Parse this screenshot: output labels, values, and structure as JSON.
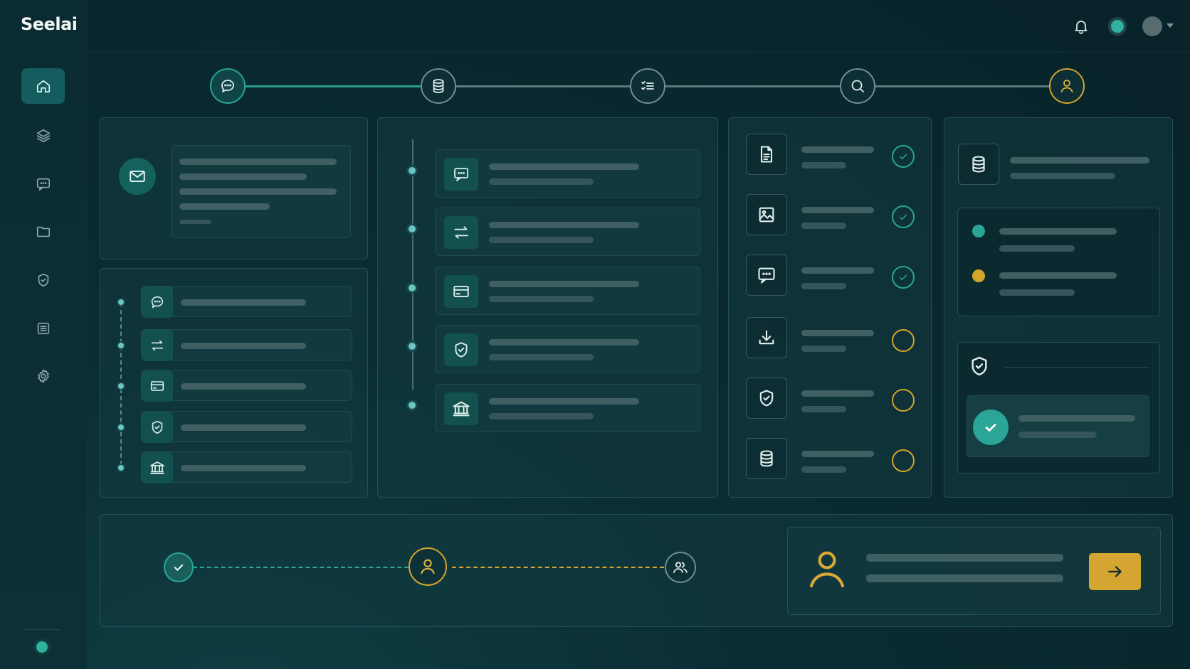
{
  "app": {
    "brand": "Seelai"
  },
  "sidebar": {
    "items": [
      {
        "icon": "home-icon",
        "active": true
      },
      {
        "icon": "layers-icon",
        "active": false
      },
      {
        "icon": "chat-icon",
        "active": false
      },
      {
        "icon": "folder-icon",
        "active": false
      },
      {
        "icon": "shield-icon",
        "active": false
      },
      {
        "icon": "list-icon",
        "active": false
      },
      {
        "icon": "gear-icon",
        "active": false
      }
    ]
  },
  "stepper": {
    "steps": [
      {
        "icon": "chat-icon",
        "state": "done"
      },
      {
        "icon": "database-icon",
        "state": "pending"
      },
      {
        "icon": "checklist-icon",
        "state": "pending"
      },
      {
        "icon": "search-icon",
        "state": "pending"
      },
      {
        "icon": "user-icon",
        "state": "current"
      }
    ]
  },
  "colors": {
    "accent_teal": "#2aa596",
    "accent_gold": "#d3a52c",
    "background": "#082329"
  },
  "checklist": {
    "items": [
      {
        "icon": "document-icon",
        "status": "complete"
      },
      {
        "icon": "image-icon",
        "status": "complete"
      },
      {
        "icon": "message-icon",
        "status": "complete"
      },
      {
        "icon": "download-icon",
        "status": "pending"
      },
      {
        "icon": "shield-check-icon",
        "status": "pending"
      },
      {
        "icon": "database-icon",
        "status": "pending"
      }
    ]
  },
  "flow": {
    "nodes": [
      {
        "icon": "check-icon",
        "state": "done"
      },
      {
        "icon": "user-icon",
        "state": "current"
      },
      {
        "icon": "users-icon",
        "state": "pending"
      }
    ]
  }
}
